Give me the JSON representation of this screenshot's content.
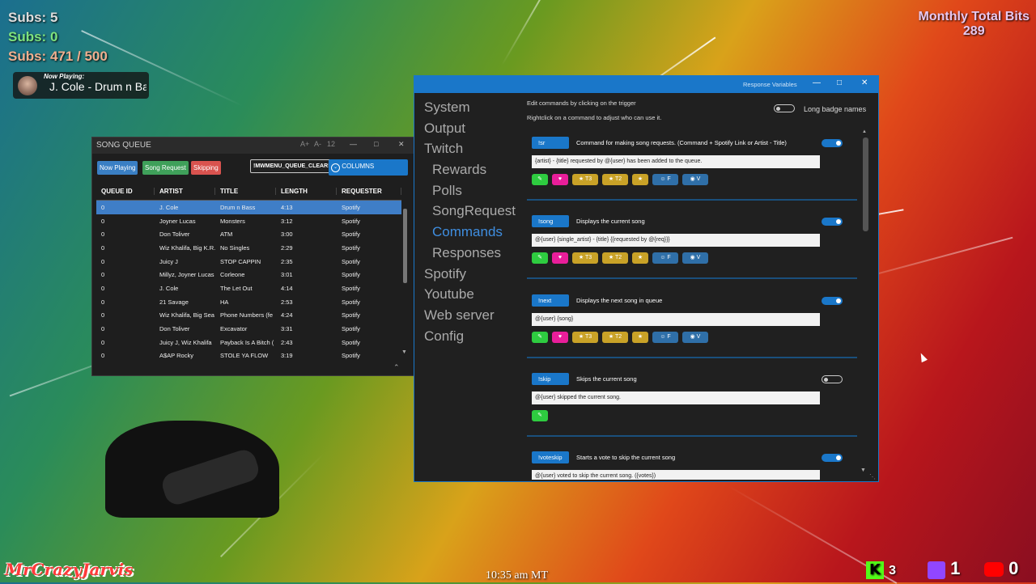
{
  "overlay": {
    "subs_line1": "Subs: 5",
    "subs_line2_prefix": "Subs: ",
    "subs_line2_value": "0",
    "subs_goal": "Subs: 471 / 500",
    "now_playing_label": "Now Playing:",
    "now_playing_song": "J. Cole - Drum n Bass",
    "monthly_bits_label": "Monthly Total Bits",
    "monthly_bits_value": "289",
    "streamer_name": "MrCrazyJarvis",
    "clock": "10:35 am MT",
    "kick_count": "3",
    "twitch_count": "1",
    "youtube_count": "0"
  },
  "song_queue": {
    "title": "SONG QUEUE",
    "font_up": "A+",
    "font_down": "A-",
    "font_size": "12",
    "buttons": {
      "now_playing": "Now Playing",
      "song_request": "Song Request",
      "skipping": "Skipping",
      "clear": "!MWMENU_QUEUE_CLEAR!",
      "columns": "COLUMNS"
    },
    "columns": [
      "QUEUE ID",
      "ARTIST",
      "TITLE",
      "LENGTH",
      "REQUESTER"
    ],
    "rows": [
      [
        "0",
        "J. Cole",
        "Drum n Bass",
        "4:13",
        "Spotify"
      ],
      [
        "0",
        "Joyner Lucas",
        "Monsters",
        "3:12",
        "Spotify"
      ],
      [
        "0",
        "Don Toliver",
        "ATM",
        "3:00",
        "Spotify"
      ],
      [
        "0",
        "Wiz Khalifa, Big K.R.",
        "No Singles",
        "2:29",
        "Spotify"
      ],
      [
        "0",
        "Juicy J",
        "STOP CAPPIN",
        "2:35",
        "Spotify"
      ],
      [
        "0",
        "Millyz, Joyner Lucas",
        "Corleone",
        "3:01",
        "Spotify"
      ],
      [
        "0",
        "J. Cole",
        "The Let Out",
        "4:14",
        "Spotify"
      ],
      [
        "0",
        "21 Savage",
        "HA",
        "2:53",
        "Spotify"
      ],
      [
        "0",
        "Wiz Khalifa, Big Sea",
        "Phone Numbers (fe",
        "4:24",
        "Spotify"
      ],
      [
        "0",
        "Don Toliver",
        "Excavator",
        "3:31",
        "Spotify"
      ],
      [
        "0",
        "Juicy J, Wiz Khalifa",
        "Payback Is A Bitch (",
        "2:43",
        "Spotify"
      ],
      [
        "0",
        "A$AP Rocky",
        "STOLE YA FLOW",
        "3:19",
        "Spotify"
      ]
    ]
  },
  "settings": {
    "title_link": "Response Variables",
    "nav": [
      "System",
      "Output",
      "Twitch",
      "Rewards",
      "Polls",
      "SongRequest",
      "Commands",
      "Responses",
      "Spotify",
      "Youtube",
      "Web server",
      "Config"
    ],
    "hint1": "Edit commands by clicking on the trigger",
    "hint2": "Rightclick on a command to adjust who can use it.",
    "long_badge_label": "Long badge names",
    "badge_labels": {
      "t3": "T3",
      "t2": "T2",
      "f": "F",
      "v": "V"
    },
    "commands": [
      {
        "trigger": "!sr",
        "desc": "Command for making song requests. (Command + Spotify Link or Artist - Title)",
        "response": "{artist} - {title} requested by @{user} has been added to the queue."
      },
      {
        "trigger": "!song",
        "desc": "Displays the current song",
        "response": "@{user} {single_artist} - {title} {{requested by @{req}}}"
      },
      {
        "trigger": "!next",
        "desc": "Displays the next song in queue",
        "response": "@{user} {song}"
      },
      {
        "trigger": "!skip",
        "desc": "Skips the current song",
        "response": "@{user} skipped the current song."
      },
      {
        "trigger": "!voteskip",
        "desc": "Starts a vote to skip the current song",
        "response": "@{user} voted to skip the current song. ({votes})"
      }
    ],
    "colors": {
      "accent": "#1a77c9",
      "green": "#2ecc40",
      "pink": "#e91e9a",
      "gold": "#c9a227",
      "blue_badge": "#2f6fa8"
    }
  }
}
